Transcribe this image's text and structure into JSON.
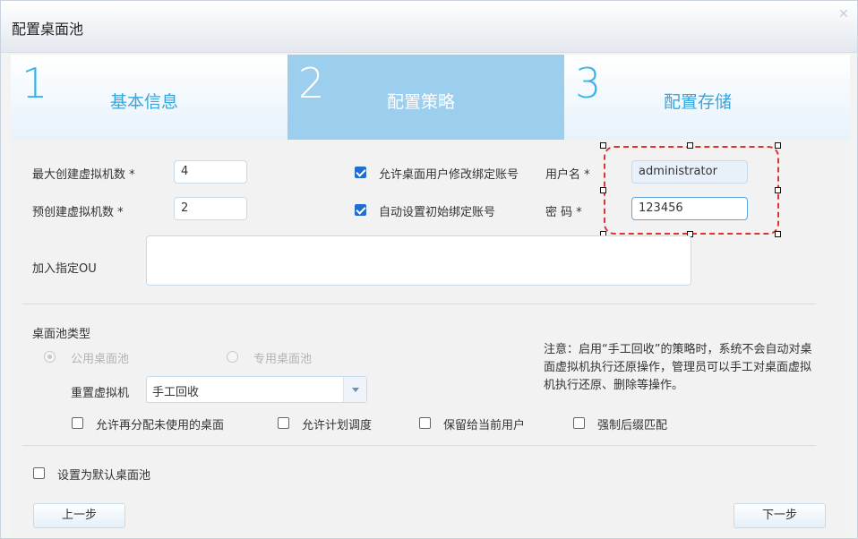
{
  "dialog": {
    "title": "配置桌面池",
    "close_icon": "close-icon"
  },
  "steps": [
    {
      "number": "1",
      "label": "基本信息",
      "active": false
    },
    {
      "number": "2",
      "label": "配置策略",
      "active": true
    },
    {
      "number": "3",
      "label": "配置存储",
      "active": false
    }
  ],
  "form": {
    "max_vm": {
      "label": "最大创建虚拟机数 *",
      "value": "4"
    },
    "pre_vm": {
      "label": "预创建虚拟机数 *",
      "value": "2"
    },
    "allow_modify_account": {
      "label": "允许桌面用户修改绑定账号",
      "checked": true
    },
    "auto_set_account": {
      "label": "自动设置初始绑定账号",
      "checked": true
    },
    "username": {
      "label": "用户名 *",
      "value": "administrator"
    },
    "password": {
      "label": "密 码 *",
      "value": "123456"
    },
    "ou": {
      "label": "加入指定OU",
      "value": ""
    },
    "pool_type": {
      "label": "桌面池类型",
      "options": [
        {
          "label": "公用桌面池",
          "selected": true
        },
        {
          "label": "专用桌面池",
          "selected": false
        }
      ]
    },
    "reset_vm": {
      "label": "重置虚拟机",
      "value": "手工回收"
    },
    "options": [
      {
        "label": "允许再分配未使用的桌面",
        "checked": false
      },
      {
        "label": "允许计划调度",
        "checked": false
      },
      {
        "label": "保留给当前用户",
        "checked": false
      },
      {
        "label": "强制后缀匹配",
        "checked": false
      }
    ],
    "note": "注意：启用“手工回收”的策略时，系统不会自动对桌面虚拟机执行还原操作，管理员可以手工对桌面虚拟机执行还原、删除等操作。",
    "default_pool": {
      "label": "设置为默认桌面池",
      "checked": false
    }
  },
  "buttons": {
    "prev": "上一步",
    "next": "下一步"
  },
  "colors": {
    "accent": "#39b4e8",
    "active_step_bg": "#9ccfee",
    "checkbox_checked": "#1f6fd1",
    "selection_box": "#dd3333"
  }
}
